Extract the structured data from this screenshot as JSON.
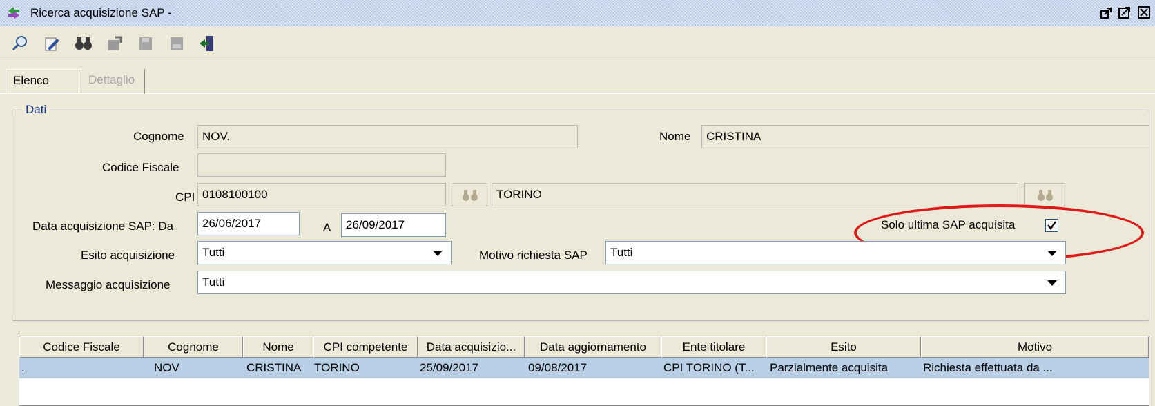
{
  "window": {
    "title": "Ricerca acquisizione SAP -",
    "icon": "app-arrows-icon",
    "controls": [
      "restore-icon",
      "maximize-icon",
      "close-icon"
    ]
  },
  "toolbar": {
    "buttons": [
      "search-icon",
      "edit-icon",
      "binoculars-icon",
      "properties-icon",
      "save-icon",
      "document-icon",
      "exit-icon"
    ]
  },
  "tabs": [
    {
      "label": "Elenco",
      "active": true
    },
    {
      "label": "Dettaglio",
      "active": false
    }
  ],
  "form": {
    "legend": "Dati",
    "cognome": {
      "label": "Cognome",
      "value": "NOV."
    },
    "nome": {
      "label": "Nome",
      "value": "CRISTINA"
    },
    "codice_fiscale": {
      "label": "Codice Fiscale",
      "value": ""
    },
    "cpi": {
      "label": "CPI",
      "code": "0108100100",
      "name": "TORINO"
    },
    "data_acquisizione": {
      "label": "Data acquisizione SAP: Da",
      "from": "26/06/2017",
      "to_label": "A",
      "to": "26/09/2017"
    },
    "solo_ultima": {
      "label": "Solo ultima SAP acquisita",
      "checked": true
    },
    "esito": {
      "label": "Esito acquisizione",
      "value": "Tutti"
    },
    "motivo": {
      "label": "Motivo richiesta SAP",
      "value": "Tutti"
    },
    "messaggio": {
      "label": "Messaggio acquisizione",
      "value": "Tutti"
    }
  },
  "highlight_color": "#e01818",
  "table": {
    "columns": [
      "Codice Fiscale",
      "Cognome",
      "Nome",
      "CPI competente",
      "Data acquisizio...",
      "Data aggiornamento",
      "Ente titolare",
      "Esito",
      "Motivo"
    ],
    "rows": [
      [
        ".",
        "NOV",
        "CRISTINA",
        "TORINO",
        "25/09/2017",
        "09/08/2017",
        "CPI TORINO (T...",
        "Parzialmente acquisita",
        "Richiesta effettuata da ..."
      ]
    ],
    "selected_row_color": "#b8cfe5"
  }
}
